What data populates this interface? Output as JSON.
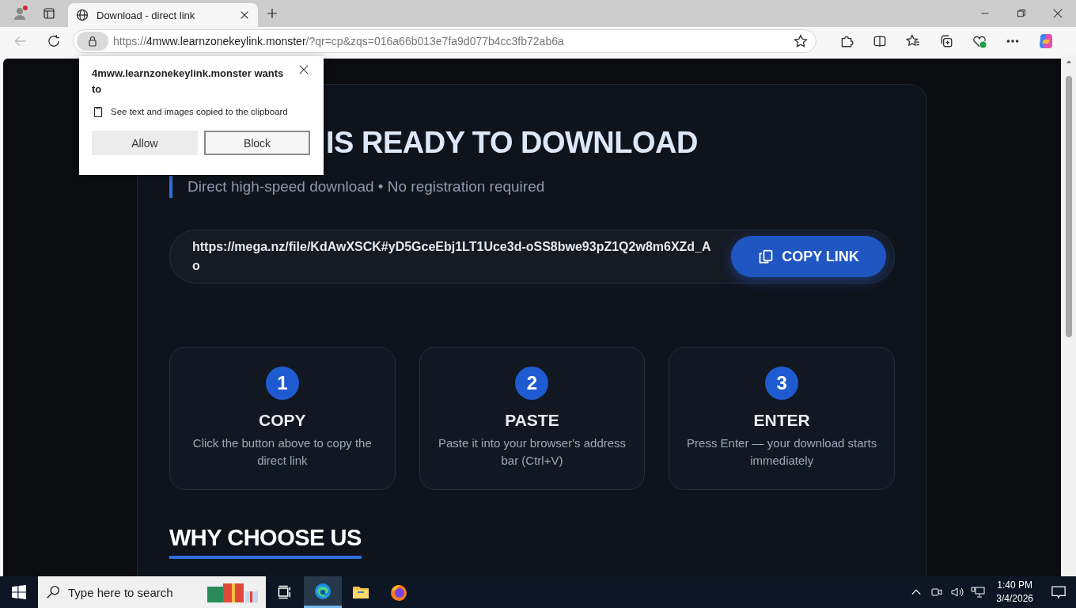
{
  "browser": {
    "tabs": [
      {
        "title": "Download - direct link",
        "selected": true
      }
    ],
    "address": {
      "scheme": "https://",
      "host": "4mww.learnzonekeylink.monster",
      "path": "/?qr=cp&zqs=016a66b013e7fa9d077b4cc3fb72ab6a"
    }
  },
  "popup": {
    "title": "4mww.learnzonekeylink.monster wants to",
    "permission": "See text and images copied to the clipboard",
    "buttons": [
      {
        "label": "Allow",
        "kind": "filled"
      },
      {
        "label": "Block",
        "kind": "outlined"
      }
    ]
  },
  "page": {
    "heading": "IS READY TO DOWNLOAD",
    "subtitle": "Direct high-speed download • No registration required",
    "link": "https://mega.nz/file/KdAwXSCK#yD5GceEbj1LT1Uce3d-oSS8bwe93pZ1Q2w8m6XZd_Ao",
    "copy_button": "COPY LINK",
    "steps": [
      {
        "number": "1",
        "title": "COPY",
        "text": "Click the button above to copy the direct link"
      },
      {
        "number": "2",
        "title": "PASTE",
        "text": "Paste it into your browser's address bar (Ctrl+V)"
      },
      {
        "number": "3",
        "title": "ENTER",
        "text": "Press Enter — your download starts immediately"
      }
    ],
    "section_title": "WHY CHOOSE US"
  },
  "taskbar": {
    "search_placeholder": "Type here to search",
    "apps": [
      {
        "kind": "taskview",
        "active": false
      },
      {
        "kind": "edge",
        "active": true
      },
      {
        "kind": "folder",
        "active": false
      },
      {
        "kind": "firefox",
        "active": false
      }
    ],
    "time": "1:40 PM",
    "date": "3/4/2026"
  }
}
